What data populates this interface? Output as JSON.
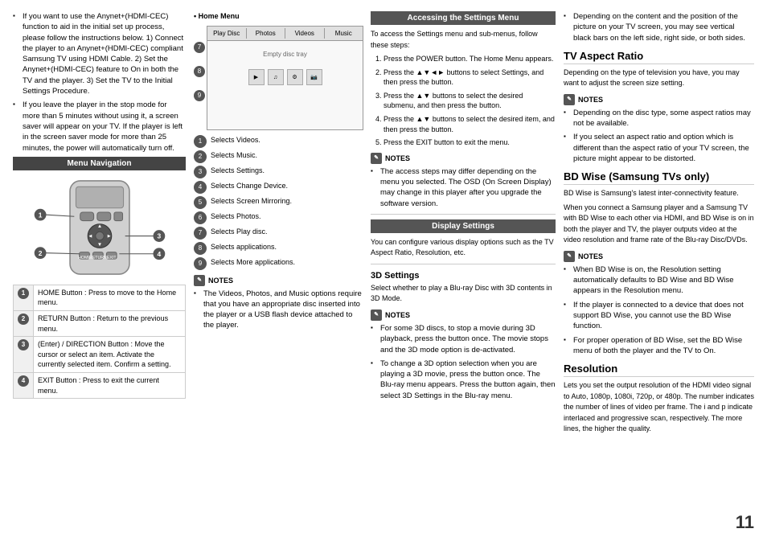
{
  "page": {
    "number": "11"
  },
  "col1": {
    "bullet_items": [
      "If you want to use the Anynet+(HDMI-CEC) function to aid in the initial set up process, please follow the instructions below. 1) Connect the player to an Anynet+(HDMI-CEC) compliant Samsung TV using HDMI Cable. 2) Set the Anynet+(HDMI-CEC) feature to On in both the TV and the player. 3) Set the TV to the Initial Settings Procedure.",
      "If you leave the player in the stop mode for more than 5 minutes without using it, a screen saver will appear on your TV. If the player is left in the screen saver mode for more than 25 minutes, the power will automatically turn off."
    ],
    "menu_nav_heading": "Menu Navigation",
    "nav_items": [
      {
        "num": "1",
        "label": "HOME Button : Press to move to the Home menu."
      },
      {
        "num": "2",
        "label": "RETURN Button : Return to the previous menu."
      },
      {
        "num": "3",
        "label": "(Enter) / DIRECTION Button : Move the cursor or select an item. Activate the currently selected item. Confirm a setting."
      },
      {
        "num": "4",
        "label": "EXIT Button : Press to exit the current menu."
      }
    ]
  },
  "col2": {
    "home_menu_label": "Home Menu",
    "menu_top_tabs": [
      "Play Disc",
      "Photos",
      "Videos",
      "Music"
    ],
    "menu_center_text": "Empty disc tray",
    "selects": [
      {
        "num": "1",
        "text": "Selects Videos."
      },
      {
        "num": "2",
        "text": "Selects Music."
      },
      {
        "num": "3",
        "text": "Selects Settings."
      },
      {
        "num": "4",
        "text": "Selects Change Device."
      },
      {
        "num": "5",
        "text": "Selects Screen Mirroring."
      },
      {
        "num": "6",
        "text": "Selects Photos."
      },
      {
        "num": "7",
        "text": "Selects Play disc."
      },
      {
        "num": "8",
        "text": "Selects applications."
      },
      {
        "num": "9",
        "text": "Selects More applications."
      }
    ],
    "notes_heading": "NOTES",
    "notes_items": [
      "The Videos, Photos, and Music options require that you have an appropriate disc inserted into the player or a USB flash device attached to the player."
    ]
  },
  "col3": {
    "accessing_heading": "Accessing the Settings Menu",
    "accessing_intro": "To access the Settings menu and sub-menus, follow these steps:",
    "steps": [
      {
        "num": "1",
        "text": "Press the POWER button. The Home Menu appears."
      },
      {
        "num": "2",
        "text": "Press the ▲▼◄► buttons to select Settings, and then press the  button."
      },
      {
        "num": "3",
        "text": "Press the ▲▼ buttons to select the desired submenu, and then press the  button."
      },
      {
        "num": "4",
        "text": "Press the ▲▼ buttons to select the desired item, and then press the  button."
      },
      {
        "num": "5",
        "text": "Press the EXIT button to exit the menu."
      }
    ],
    "notes_heading": "NOTES",
    "notes_items": [
      "The access steps may differ depending on the menu you selected. The OSD (On Screen Display) may change in this player after you upgrade the software version."
    ],
    "display_heading": "Display Settings",
    "display_intro": "You can configure various display options such as the TV Aspect Ratio, Resolution, etc.",
    "3d_title": "3D Settings",
    "3d_intro": "Select whether to play a Blu-ray Disc with 3D contents in 3D Mode.",
    "3d_notes_heading": "NOTES",
    "3d_notes_items": [
      "For some 3D discs, to stop a movie during 3D playback, press the  button once. The movie stops and the 3D mode option is de-activated.",
      "To change a 3D option selection when you are playing a 3D movie, press the  button once. The Blu-ray menu appears. Press the  button again, then select 3D Settings in the Blu-ray menu."
    ]
  },
  "col4": {
    "tv_aspect_bullet": "Depending on the content and the position of the picture on your TV screen, you may see vertical black bars on the left side, right side, or both sides.",
    "tv_aspect_title": "TV Aspect Ratio",
    "tv_aspect_intro": "Depending on the type of television you have, you may want to adjust the screen size setting.",
    "tv_notes_heading": "NOTES",
    "tv_notes_items": [
      "Depending on the disc type, some aspect ratios may not be available.",
      "If you select an aspect ratio and option which is different than the aspect ratio of your TV screen, the picture might appear to be distorted."
    ],
    "bd_wise_title": "BD Wise (Samsung TVs only)",
    "bd_wise_intro": "BD Wise is Samsung's latest inter-connectivity feature.",
    "bd_wise_body": "When you connect a Samsung player and a Samsung TV with BD Wise to each other via HDMI, and BD Wise is on in both the player and TV, the player outputs video at the video resolution and frame rate of the Blu-ray Disc/DVDs.",
    "bd_wise_notes_heading": "NOTES",
    "bd_wise_notes_items": [
      "When BD Wise is on, the Resolution setting automatically defaults to BD Wise and BD Wise appears in the Resolution menu.",
      "If the player is connected to a device that does not support BD Wise, you cannot use the BD Wise function.",
      "For proper operation of BD Wise, set the BD Wise menu of both the player and the TV to On."
    ],
    "resolution_title": "Resolution",
    "resolution_body": "Lets you set the output resolution of the HDMI video signal to Auto, 1080p, 1080i, 720p, or 480p. The number indicates the number of lines of video per frame. The i and p indicate interlaced and progressive scan, respectively. The more lines, the higher the quality."
  }
}
